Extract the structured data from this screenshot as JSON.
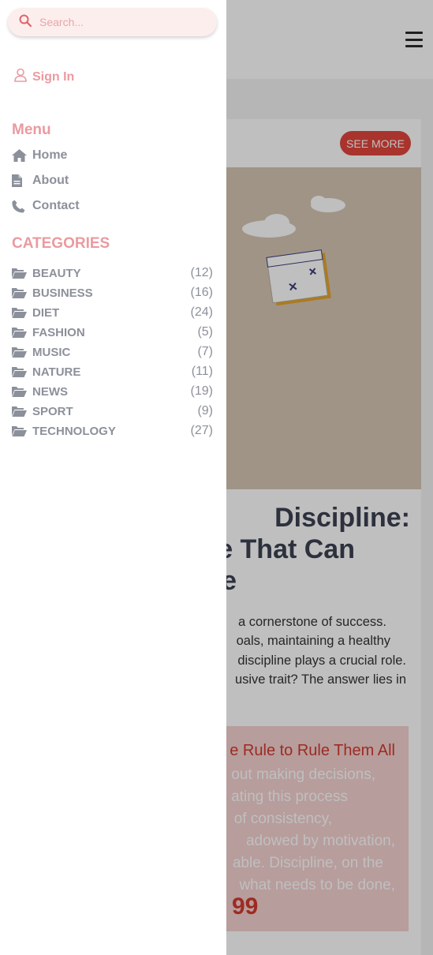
{
  "drawer": {
    "search_placeholder": "Search...",
    "sign_in": "Sign In",
    "menu_title": "Menu",
    "menu_items": [
      {
        "label": "Home",
        "icon": "home-icon"
      },
      {
        "label": "About",
        "icon": "document-icon"
      },
      {
        "label": "Contact",
        "icon": "phone-icon"
      }
    ],
    "categories_title": "CATEGORIES",
    "categories": [
      {
        "name": "BEAUTY",
        "count": "(12)"
      },
      {
        "name": "BUSINESS",
        "count": "(16)"
      },
      {
        "name": "DIET",
        "count": "(24)"
      },
      {
        "name": "FASHION",
        "count": "(5)"
      },
      {
        "name": "MUSIC",
        "count": "(7)"
      },
      {
        "name": "NATURE",
        "count": "(11)"
      },
      {
        "name": "NEWS",
        "count": "(19)"
      },
      {
        "name": "SPORT",
        "count": "(9)"
      },
      {
        "name": "TECHNOLOGY",
        "count": "(27)"
      }
    ]
  },
  "background": {
    "see_more": "SEE MORE",
    "post_title_lines": [
      "Discipline:",
      "e That Can",
      "fe"
    ],
    "excerpt_lines": [
      "a cornerstone of success.",
      "oals, maintaining a healthy",
      "discipline plays a crucial role.",
      "usive trait? The answer lies in"
    ],
    "quote_title": "e Rule to Rule Them All",
    "quote_lines": [
      "out making decisions,",
      "ating this process",
      "of consistency,",
      "adowed by motivation,",
      "able. Discipline, on the",
      "what needs to be done,"
    ],
    "quote_mark": "99"
  },
  "colors": {
    "accent_pink": "#eb9aa0",
    "button_red": "#e0463c",
    "muted_gray": "#8c909a"
  }
}
